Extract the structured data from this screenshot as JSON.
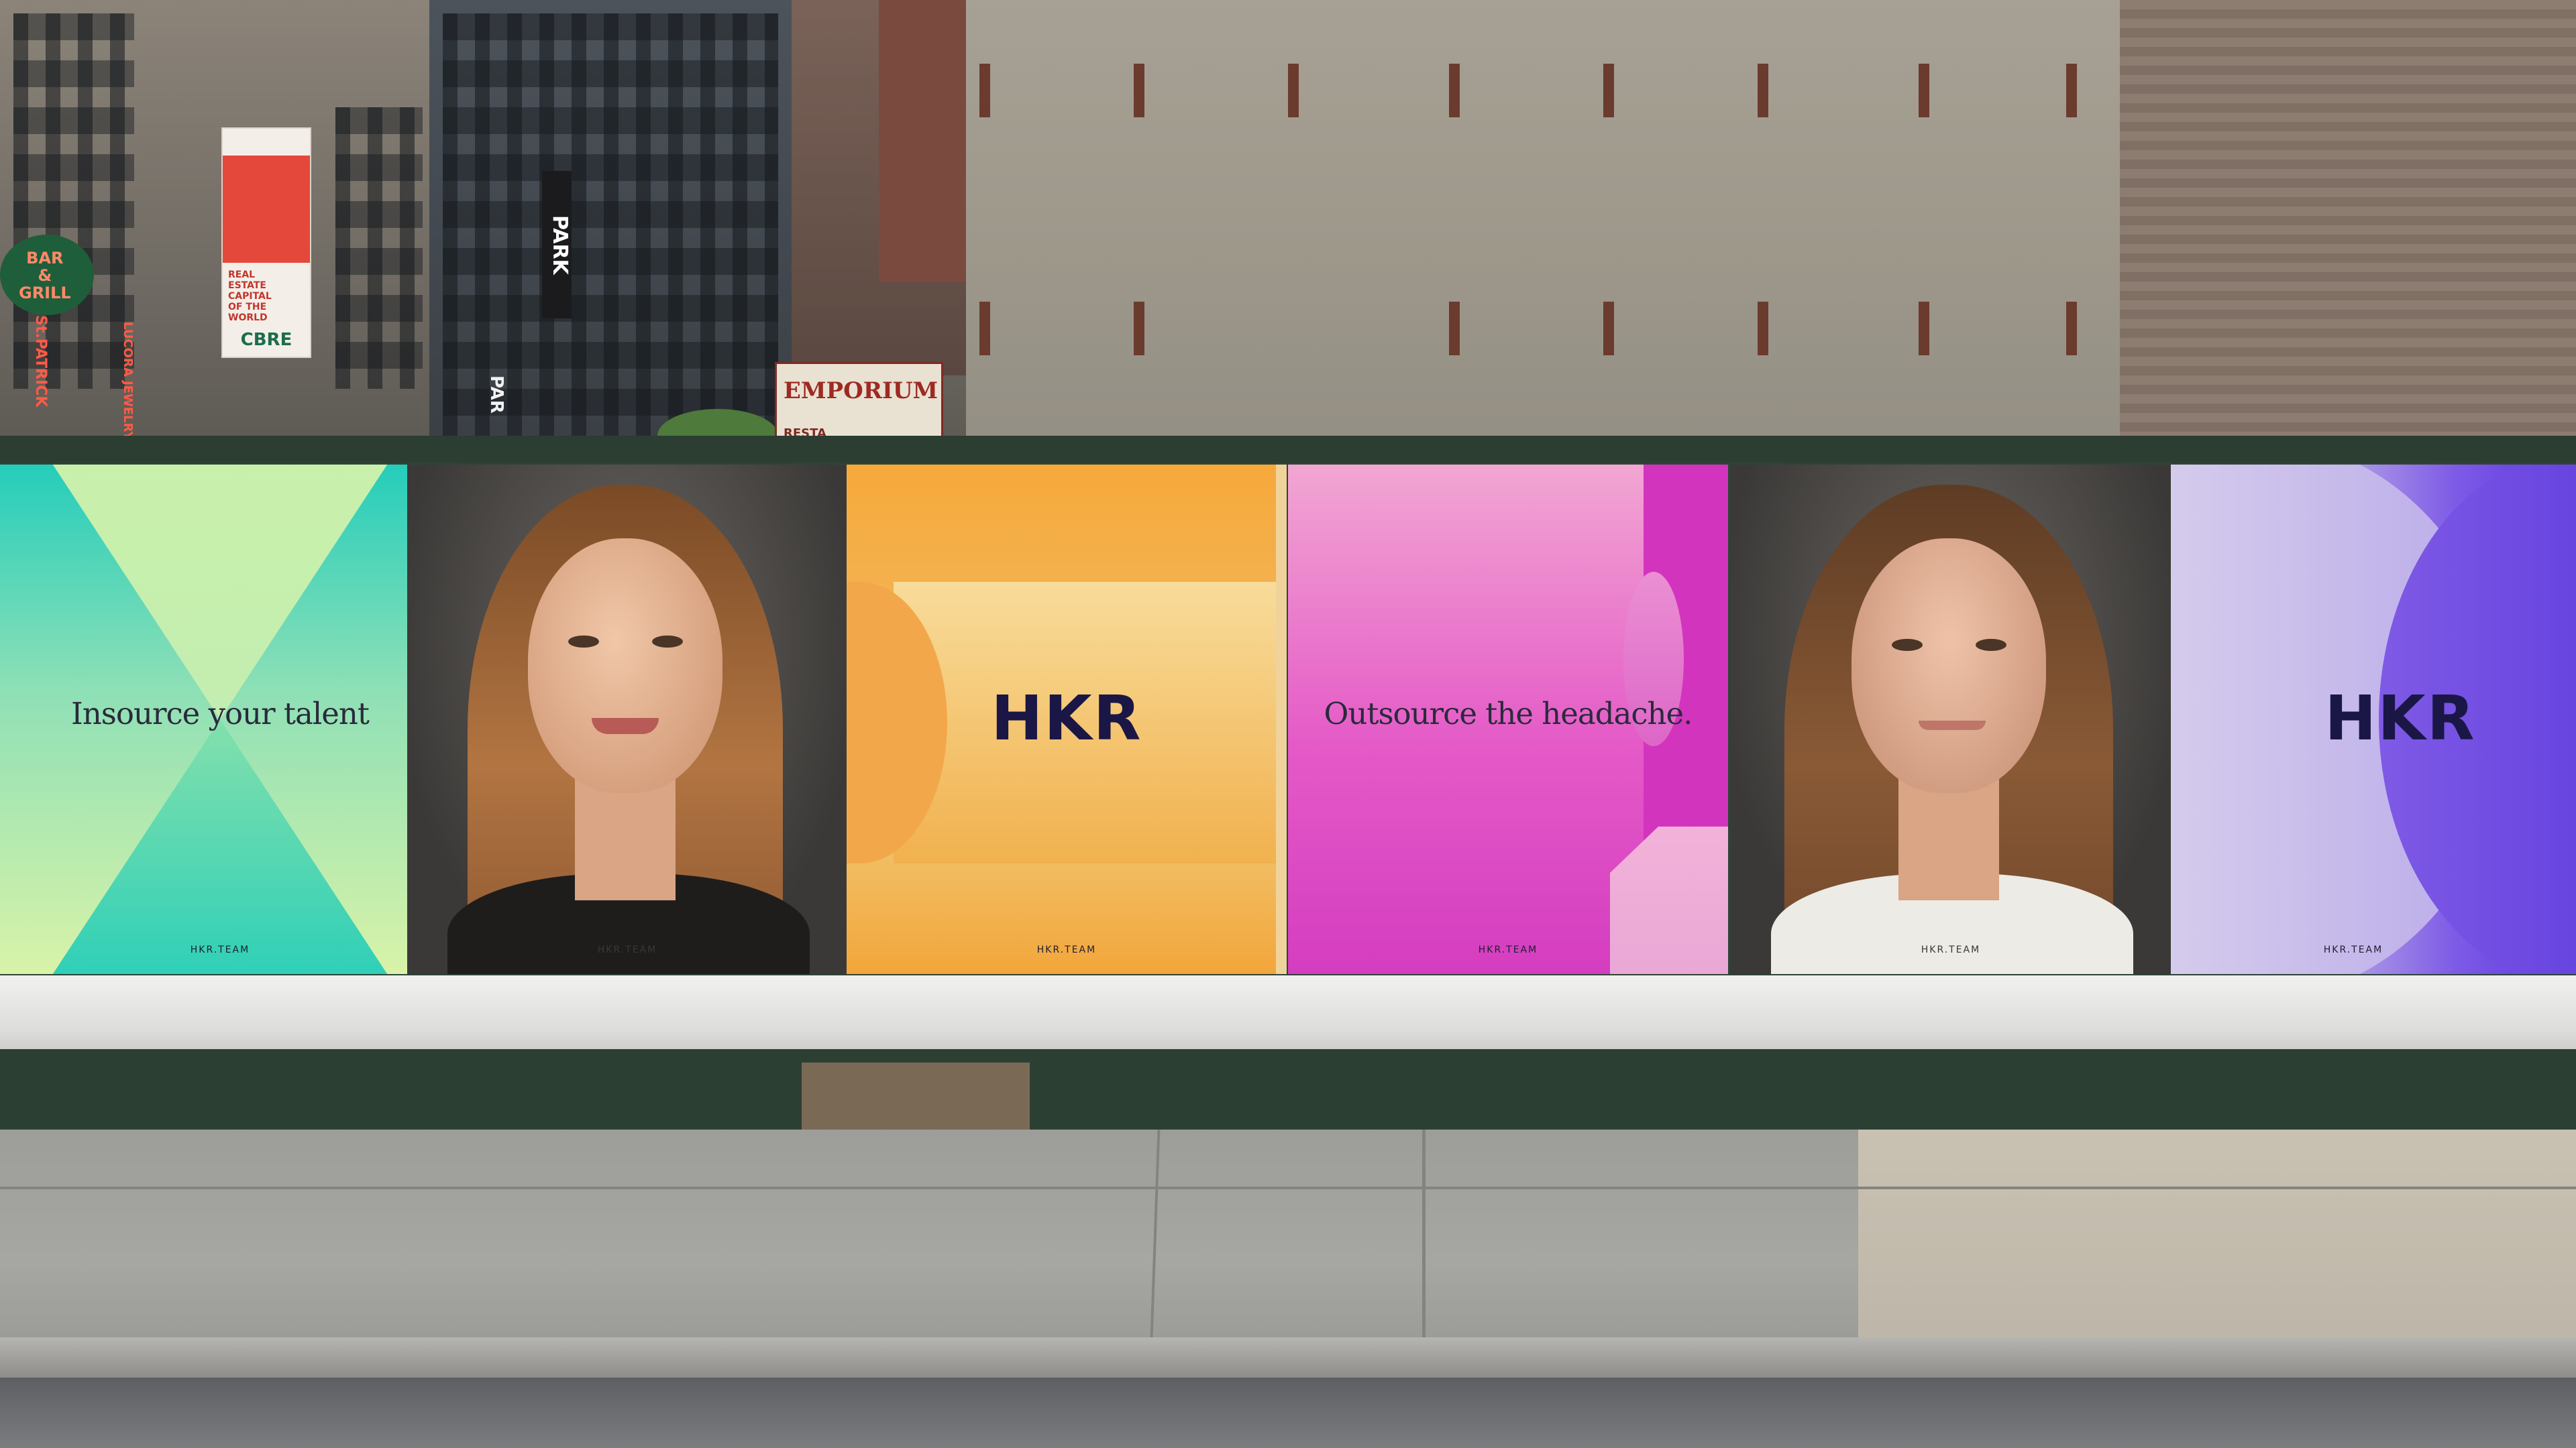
{
  "scene": "street hoarding with posters",
  "signs": {
    "bar_grill": "BAR\n&\nGRILL",
    "st_patricks": "St.PATRICK",
    "lucora_jewelry": "LUCORA JEWELRY",
    "cbre_banner_text": "REAL\nESTATE\nCAPITAL\nOF THE\nWORLD",
    "cbre_brand": "CBRE",
    "park": "PARK",
    "park_lower": "PAR",
    "emporium": "EMPORIUM",
    "emporium_sub": "RESTA"
  },
  "posters": [
    {
      "kind": "text",
      "headline": "Insource your talent",
      "footer": "HKR.TEAM",
      "accent": "#25cdbb"
    },
    {
      "kind": "portrait",
      "footer": "HKR.TEAM",
      "accent": "#3f3c3a"
    },
    {
      "kind": "logo",
      "logo": "HKR",
      "footer": "HKR.TEAM",
      "accent": "#f6a93b"
    },
    {
      "kind": "text",
      "headline": "Outsource the headache.",
      "footer": "HKR.TEAM",
      "accent": "#e45ac7"
    },
    {
      "kind": "portrait",
      "footer": "HKR.TEAM",
      "accent": "#5b5a57"
    },
    {
      "kind": "logo",
      "logo": "HKR",
      "footer": "HKR.TEAM",
      "accent": "#6a44e0"
    }
  ]
}
